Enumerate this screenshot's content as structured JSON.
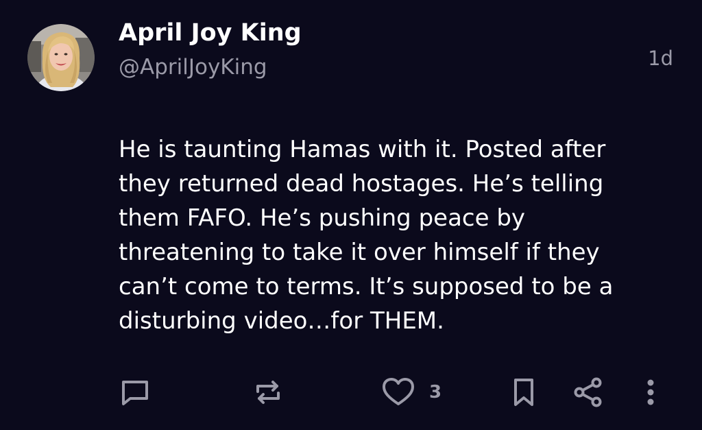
{
  "author": {
    "display_name": "April Joy King",
    "handle": "@AprilJoyKing"
  },
  "post": {
    "timestamp": "1d",
    "text_lines": [
      "He is taunting Hamas with it. Posted after",
      "they returned dead hostages. He’s telling",
      "them FAFO. He’s pushing peace by",
      "threatening to take it over himself if they",
      "can’t come to terms. It’s supposed to be a",
      "disturbing video…for THEM."
    ]
  },
  "actions": {
    "reply_icon": "comment-icon",
    "repost_icon": "repost-icon",
    "like_icon": "heart-icon",
    "like_count": "3",
    "bookmark_icon": "bookmark-icon",
    "share_icon": "share-icon",
    "more_icon": "more-vertical-icon"
  },
  "colors": {
    "background": "#0b0a1c",
    "primary_text": "#ffffff",
    "secondary_text": "#9b9aa8"
  }
}
